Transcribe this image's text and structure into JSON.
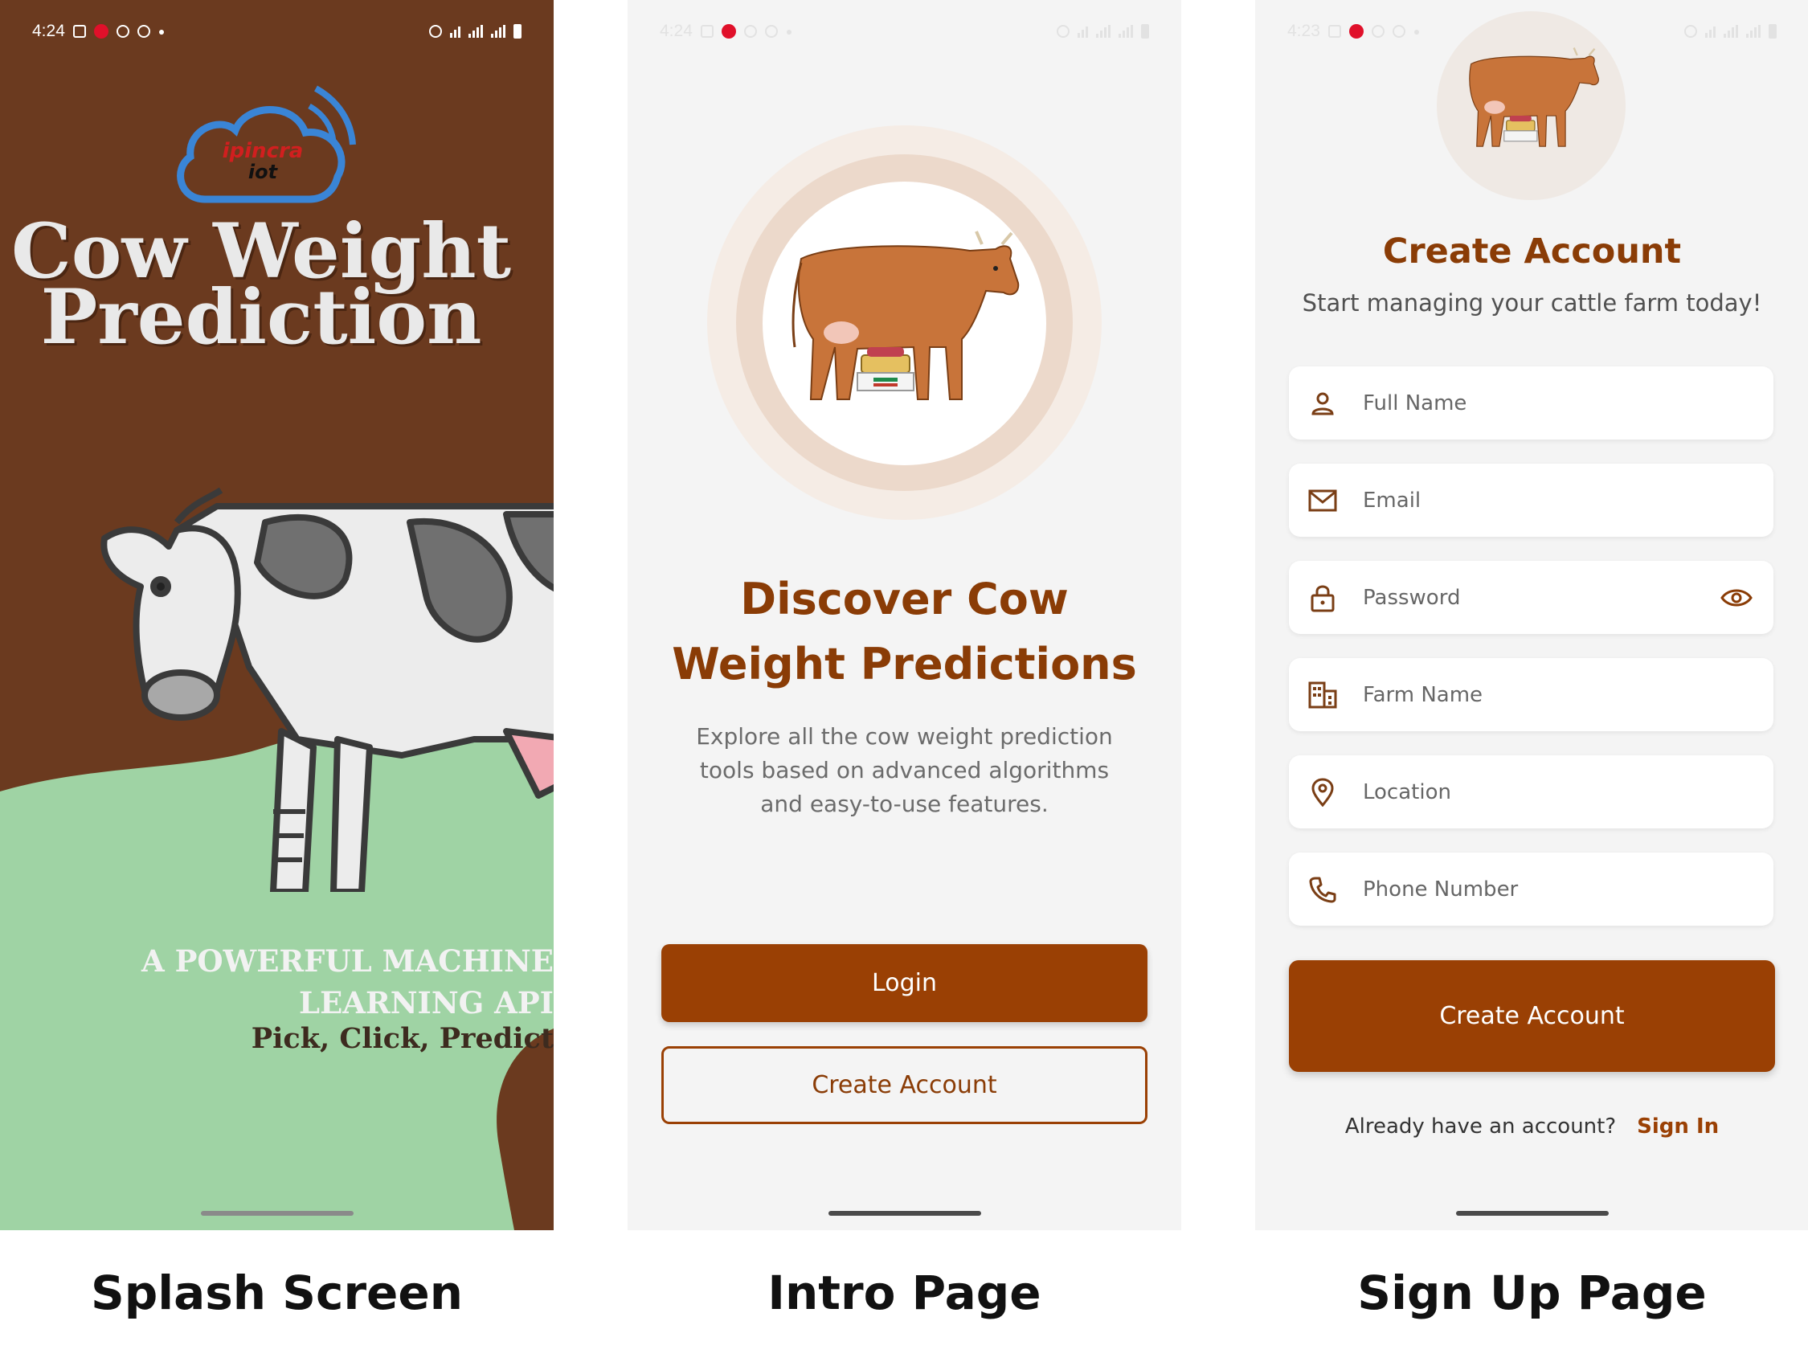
{
  "colors": {
    "brown": "#9a4004",
    "title_brown": "#8a3c06",
    "splash_bg": "#6b3a1f",
    "grass": "#9fd3a4",
    "bg": "#f4f4f4"
  },
  "splash": {
    "status_time": "4:24",
    "logo_text_1": "ipincra",
    "logo_text_2": "iot",
    "title_line1": "Cow Weight",
    "title_line2": "Prediction",
    "tagline_line1": "A POWERFUL MACHINE",
    "tagline_line2": "LEARNING API",
    "tagline_line3": "Pick, Click, Predict"
  },
  "intro": {
    "status_time": "4:24",
    "title": "Discover Cow Weight Predictions",
    "description": "Explore all the cow weight prediction tools based on advanced algorithms and easy-to-use features.",
    "login_label": "Login",
    "create_label": "Create Account"
  },
  "signup": {
    "status_time": "4:23",
    "title": "Create Account",
    "subtitle": "Start managing your cattle farm today!",
    "fields": [
      {
        "placeholder": "Full Name",
        "icon": "person-icon"
      },
      {
        "placeholder": "Email",
        "icon": "mail-icon"
      },
      {
        "placeholder": "Password",
        "icon": "lock-icon"
      },
      {
        "placeholder": "Farm Name",
        "icon": "building-icon"
      },
      {
        "placeholder": "Location",
        "icon": "location-pin-icon"
      },
      {
        "placeholder": "Phone Number",
        "icon": "phone-icon"
      }
    ],
    "create_label": "Create Account",
    "already_text": "Already have an account?",
    "signin_label": "Sign In"
  },
  "captions": {
    "splash": "Splash Screen",
    "intro": "Intro Page",
    "signup": "Sign Up Page"
  }
}
